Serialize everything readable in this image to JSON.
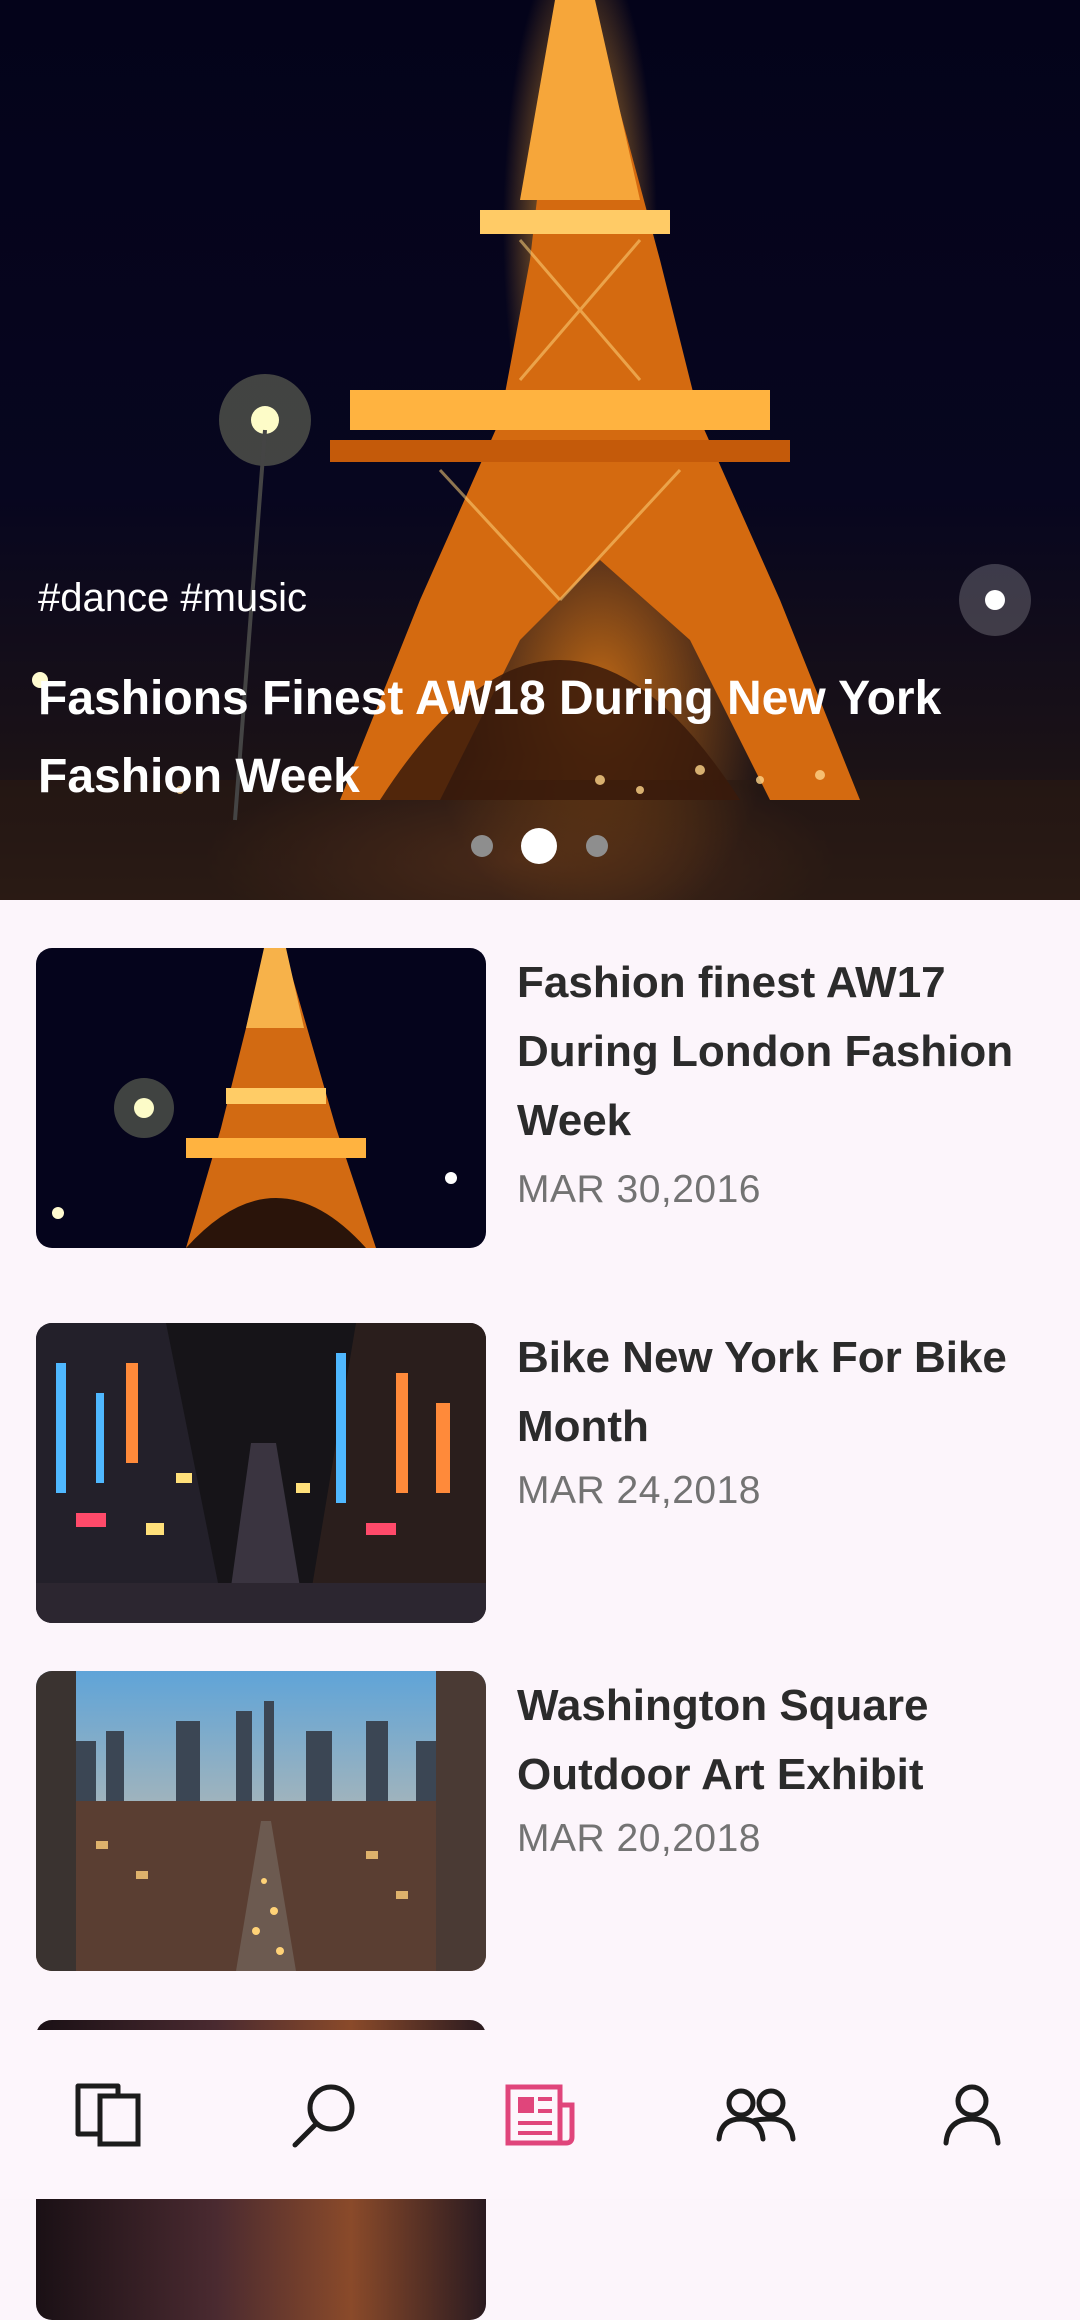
{
  "hero": {
    "tags": "#dance #music",
    "title": "Fashions Finest AW18 During New York Fashion Week",
    "carousel": {
      "count": 3,
      "active_index": 1
    }
  },
  "articles": [
    {
      "title": "Fashion finest AW17 During London Fashion Week",
      "date": "MAR 30,2016",
      "image": "eiffel-tower-night"
    },
    {
      "title": "Bike New York For Bike Month",
      "date": "MAR 24,2018",
      "image": "neon-city-street"
    },
    {
      "title": "Washington Square Outdoor Art Exhibit",
      "date": "MAR 20,2018",
      "image": "city-skyline-dusk"
    }
  ],
  "bottom_nav": {
    "items": [
      {
        "icon": "copy-icon"
      },
      {
        "icon": "search-icon"
      },
      {
        "icon": "news-icon",
        "active": true
      },
      {
        "icon": "people-icon"
      },
      {
        "icon": "profile-icon"
      }
    ],
    "active_color": "#e0457b",
    "inactive_color": "#1c1c1c"
  }
}
